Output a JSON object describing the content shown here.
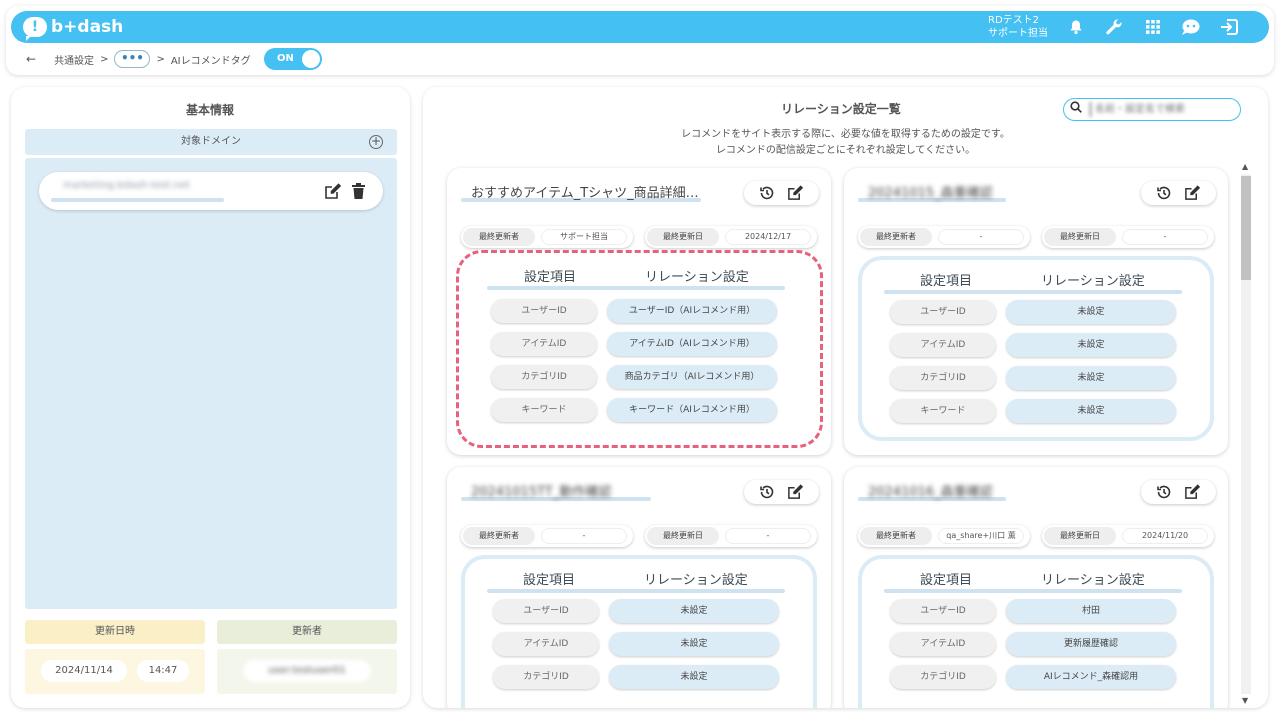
{
  "header": {
    "logo_text": "b+dash",
    "logo_mark": "!",
    "user_line1": "RDテスト2",
    "user_line2": "サポート担当",
    "icons": [
      "bell-icon",
      "wrench-icon",
      "grid-icon",
      "chat-bot-icon",
      "logout-icon"
    ]
  },
  "breadcrumb": {
    "back": "←",
    "item1": "共通設定",
    "sep": ">",
    "ellipsis": "•••",
    "current": "AIレコメンドタグ",
    "toggle_label": "ON"
  },
  "basic_info": {
    "title": "基本情報",
    "domain_header": "対象ドメイン",
    "domains": [
      "marketing.bdash-test.net"
    ],
    "updated_at_label": "更新日時",
    "updated_by_label": "更新者",
    "updated_date": "2024/11/14",
    "updated_time": "14:47",
    "updated_by": "user.testuser01"
  },
  "relation": {
    "title": "リレーション設定一覧",
    "search_placeholder": "名前・設定名で検索",
    "desc_line1": "レコメンドをサイト表示する際に、必要な値を取得するための設定です。",
    "desc_line2": "レコメンドの配信設定ごとにそれぞれ設定してください。",
    "col_item": "設定項目",
    "col_relation": "リレーション設定",
    "updater_label": "最終更新者",
    "date_label": "最終更新日",
    "cards": [
      {
        "name": "おすすめアイテム_Tシャツ_商品詳細…",
        "updater": "サポート担当",
        "date": "2024/12/17",
        "rows": [
          {
            "key": "ユーザーID",
            "value": "ユーザーID（AIレコメンド用）"
          },
          {
            "key": "アイテムID",
            "value": "アイテムID（AIレコメンド用）"
          },
          {
            "key": "カテゴリID",
            "value": "商品カテゴリ（AIレコメンド用）"
          },
          {
            "key": "キーワード",
            "value": "キーワード（AIレコメンド用）"
          }
        ]
      },
      {
        "name": "20241015_森重確認",
        "updater": "-",
        "date": "-",
        "rows": [
          {
            "key": "ユーザーID",
            "value": "未設定"
          },
          {
            "key": "アイテムID",
            "value": "未設定"
          },
          {
            "key": "カテゴリID",
            "value": "未設定"
          },
          {
            "key": "キーワード",
            "value": "未設定"
          }
        ]
      },
      {
        "name": "20241015TT_動作確認",
        "updater": "-",
        "date": "-",
        "rows": [
          {
            "key": "ユーザーID",
            "value": "未設定"
          },
          {
            "key": "アイテムID",
            "value": "未設定"
          },
          {
            "key": "カテゴリID",
            "value": "未設定"
          }
        ]
      },
      {
        "name": "20241016_森重確認",
        "updater": "qa_share+川口 薫",
        "date": "2024/11/20",
        "rows": [
          {
            "key": "ユーザーID",
            "value": "村田"
          },
          {
            "key": "アイテムID",
            "value": "更新履歴確認"
          },
          {
            "key": "カテゴリID",
            "value": "AIレコメンド_森確認用"
          }
        ]
      }
    ]
  },
  "colors": {
    "accent": "#44c0f3",
    "panel_blue": "#dcecf7",
    "highlight_dash": "#e8617c",
    "updated_at_bg": "#fbefc8",
    "updated_by_bg": "#e9eeda"
  }
}
